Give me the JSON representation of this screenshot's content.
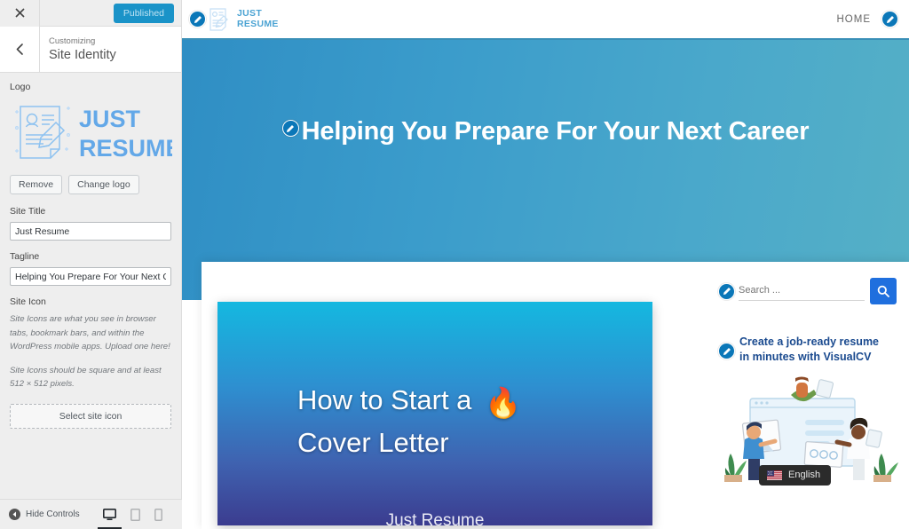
{
  "customizer": {
    "close_label": "Close",
    "publish_label": "Published",
    "back_label": "Back",
    "eyebrow": "Customizing",
    "panel_title": "Site Identity",
    "logo": {
      "section_label": "Logo",
      "brand_line1": "JUST",
      "brand_line2": "RESUME",
      "remove_label": "Remove",
      "change_label": "Change logo"
    },
    "site_title": {
      "label": "Site Title",
      "value": "Just Resume"
    },
    "tagline": {
      "label": "Tagline",
      "value": "Helping You Prepare For Your Next Career"
    },
    "site_icon": {
      "label": "Site Icon",
      "description_1": "Site Icons are what you see in browser tabs, bookmark bars, and within the WordPress mobile apps. Upload one here!",
      "description_2": "Site Icons should be square and at least 512 × 512 pixels.",
      "upload_label": "Select site icon"
    },
    "footer": {
      "hide_controls_label": "Hide Controls",
      "devices": [
        {
          "name": "desktop",
          "active": true
        },
        {
          "name": "tablet",
          "active": false
        },
        {
          "name": "mobile",
          "active": false
        }
      ]
    },
    "colors": {
      "publish_bg": "#1a93c8",
      "sidebar_bg": "#eeeeee",
      "logo_blue": "#63a8e8"
    }
  },
  "preview": {
    "header": {
      "brand_line1": "JUST",
      "brand_line2": "RESUME",
      "nav": [
        "HOME"
      ]
    },
    "hero": {
      "heading": "Helping You Prepare For Your Next Career",
      "accent_from": "#2f8ec4",
      "accent_to": "#55b0c6"
    },
    "post_card": {
      "title_line1": "How to Start a",
      "title_line2": "Cover Letter",
      "emoji": "🔥",
      "caption": "Just Resume"
    },
    "widgets": {
      "search_placeholder": "Search ...",
      "search_value": "",
      "search_icon": "magnifier-icon",
      "promo_line1": "Create a job-ready resume",
      "promo_line2": "in minutes with VisualCV"
    },
    "language": {
      "label": "English"
    }
  }
}
